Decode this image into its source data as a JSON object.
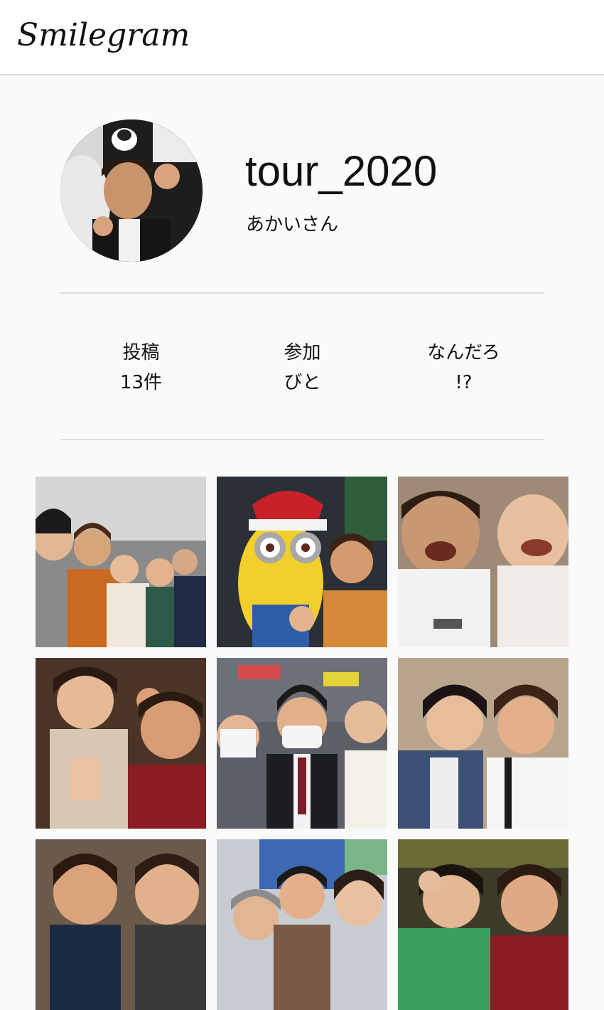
{
  "app": {
    "logo_text": "Smilegram"
  },
  "profile": {
    "username": "tour_2020",
    "display_name": "あかいさん"
  },
  "stats": [
    {
      "label": "投稿",
      "value": "13件"
    },
    {
      "label": "参加",
      "value": "びと"
    },
    {
      "label": "なんだろ",
      "value": "!?"
    }
  ],
  "colors": {
    "header_bg": "#ffffff",
    "page_bg": "#fafafa",
    "divider": "#dddddd"
  },
  "posts": [
    {
      "id": "post-1"
    },
    {
      "id": "post-2"
    },
    {
      "id": "post-3"
    },
    {
      "id": "post-4"
    },
    {
      "id": "post-5"
    },
    {
      "id": "post-6"
    },
    {
      "id": "post-7"
    },
    {
      "id": "post-8"
    },
    {
      "id": "post-9"
    }
  ]
}
